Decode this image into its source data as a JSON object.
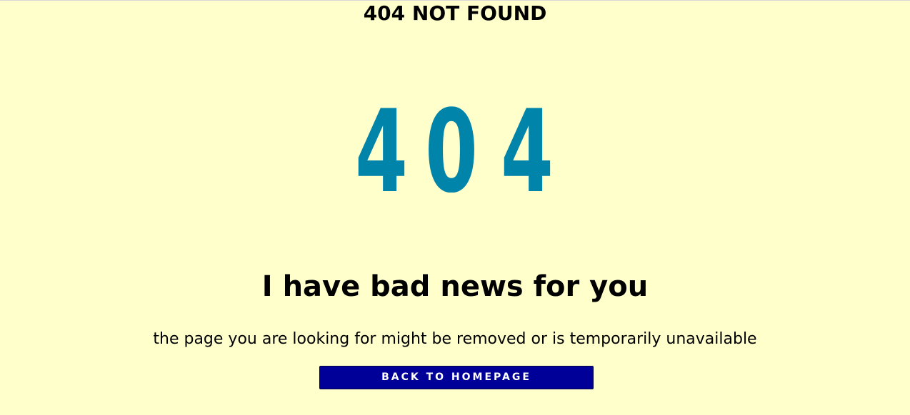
{
  "page": {
    "title": "404 NOT FOUND",
    "code_digits": [
      "4",
      "0",
      "4"
    ],
    "headline": "I have bad news for you",
    "message": "the page you are looking for might be removed or is temporarily unavailable",
    "button_label": "BACK TO HOMEPAGE"
  },
  "colors": {
    "background": "#ffffcc",
    "code": "#0084aa",
    "button": "#000099",
    "button_text": "#ffffff"
  }
}
